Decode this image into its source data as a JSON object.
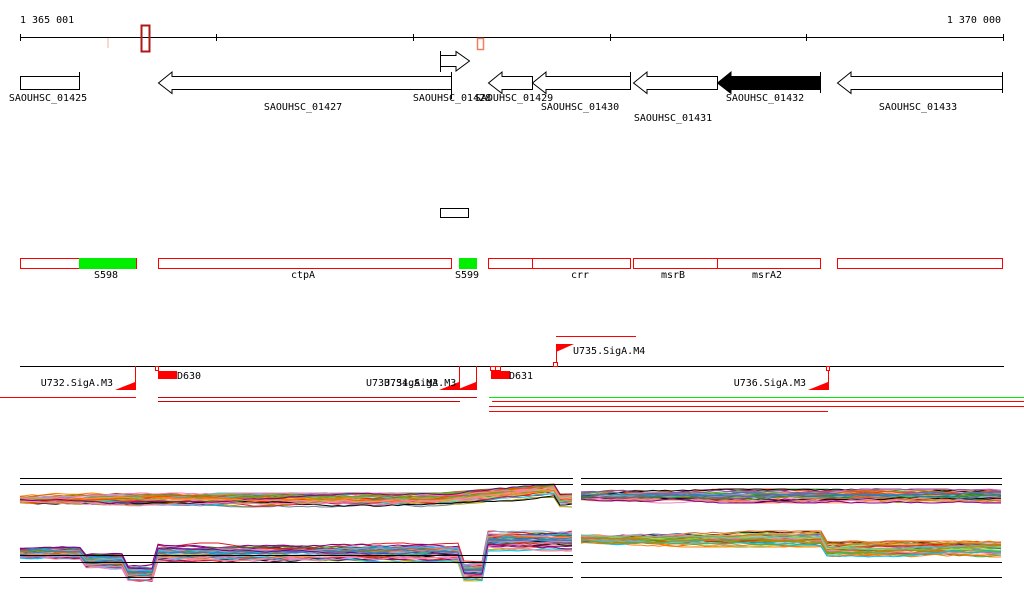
{
  "ruler": {
    "start_label": "1 365 001",
    "end_label": "1 370 000"
  },
  "genes": [
    {
      "name": "SAOUHSC_01425",
      "strand": "+",
      "filled": false
    },
    {
      "name": "SAOUHSC_01427",
      "strand": "-",
      "filled": false
    },
    {
      "name": "SAOUHSC_01428",
      "strand": "+",
      "filled": false
    },
    {
      "name": "SAOUHSC_01429",
      "strand": "-",
      "filled": false
    },
    {
      "name": "SAOUHSC_01430",
      "strand": "-",
      "filled": false
    },
    {
      "name": "SAOUHSC_01431",
      "strand": "-",
      "filled": false
    },
    {
      "name": "SAOUHSC_01432",
      "strand": "-",
      "filled": true
    },
    {
      "name": "SAOUHSC_01433",
      "strand": "-",
      "filled": false
    }
  ],
  "features": [
    {
      "name": "S598"
    },
    {
      "name": "ctpA"
    },
    {
      "name": "S599"
    },
    {
      "name": "crr"
    },
    {
      "name": "msrB"
    },
    {
      "name": "msrA2"
    }
  ],
  "promoters": [
    {
      "name": "U732.SigA.M3"
    },
    {
      "name": "U733.SigA.M3"
    },
    {
      "name": "U734.SigA.M3"
    },
    {
      "name": "U735.SigA.M4"
    },
    {
      "name": "U736.SigA.M3"
    }
  ],
  "terminators": [
    {
      "name": "D630"
    },
    {
      "name": "D631"
    }
  ],
  "colors": {
    "feature": "#ff0000",
    "srna": "#00ee00",
    "gene": "#000000"
  }
}
